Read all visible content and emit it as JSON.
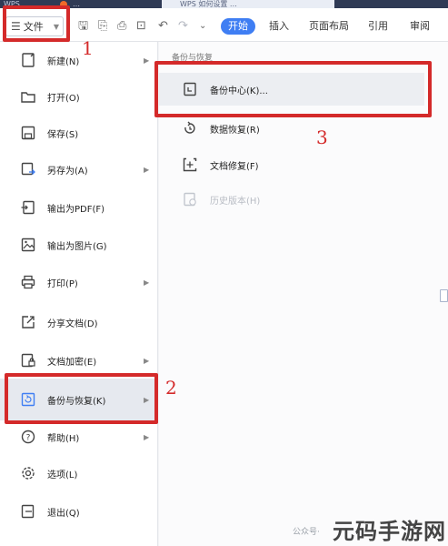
{
  "titlebar": {
    "tabs": [
      "WPS",
      "…",
      "WPS 如何设置 …"
    ]
  },
  "ribbon": {
    "file_menu_label": "文件",
    "tabs": [
      {
        "label": "开始",
        "active": true
      },
      {
        "label": "插入",
        "active": false
      },
      {
        "label": "页面布局",
        "active": false
      },
      {
        "label": "引用",
        "active": false
      },
      {
        "label": "审阅",
        "active": false
      }
    ],
    "accent_color": "#3f7ef3"
  },
  "menu": {
    "items": [
      {
        "label": "新建(N)",
        "icon": "new-doc-icon",
        "arrow": true
      },
      {
        "label": "打开(O)",
        "icon": "folder-icon",
        "arrow": false
      },
      {
        "label": "保存(S)",
        "icon": "save-icon",
        "arrow": false
      },
      {
        "label": "另存为(A)",
        "icon": "save-as-icon",
        "arrow": true
      },
      {
        "label": "输出为PDF(F)",
        "icon": "export-pdf-icon",
        "arrow": false
      },
      {
        "label": "输出为图片(G)",
        "icon": "export-image-icon",
        "arrow": false
      },
      {
        "label": "打印(P)",
        "icon": "printer-icon",
        "arrow": true
      },
      {
        "label": "分享文档(D)",
        "icon": "share-icon",
        "arrow": false
      },
      {
        "label": "文档加密(E)",
        "icon": "encrypt-icon",
        "arrow": true
      },
      {
        "label": "备份与恢复(K)",
        "icon": "backup-icon",
        "arrow": true,
        "selected": true
      },
      {
        "label": "帮助(H)",
        "icon": "help-icon",
        "arrow": true
      },
      {
        "label": "选项(L)",
        "icon": "gear-icon",
        "arrow": false
      },
      {
        "label": "退出(Q)",
        "icon": "exit-icon",
        "arrow": false
      }
    ]
  },
  "submenu": {
    "title": "备份与恢复",
    "items": [
      {
        "label": "备份中心(K)...",
        "icon": "backup-center-icon",
        "highlight": true
      },
      {
        "label": "数据恢复(R)",
        "icon": "data-recovery-icon"
      },
      {
        "label": "文档修复(F)",
        "icon": "doc-repair-icon"
      },
      {
        "label": "历史版本(H)",
        "icon": "history-icon",
        "disabled": true
      }
    ]
  },
  "annotations": {
    "step1": "1",
    "step2": "2",
    "step3": "3",
    "color": "#d42a2a"
  },
  "watermark": {
    "small": "公众号·",
    "big": "元码手游网"
  }
}
